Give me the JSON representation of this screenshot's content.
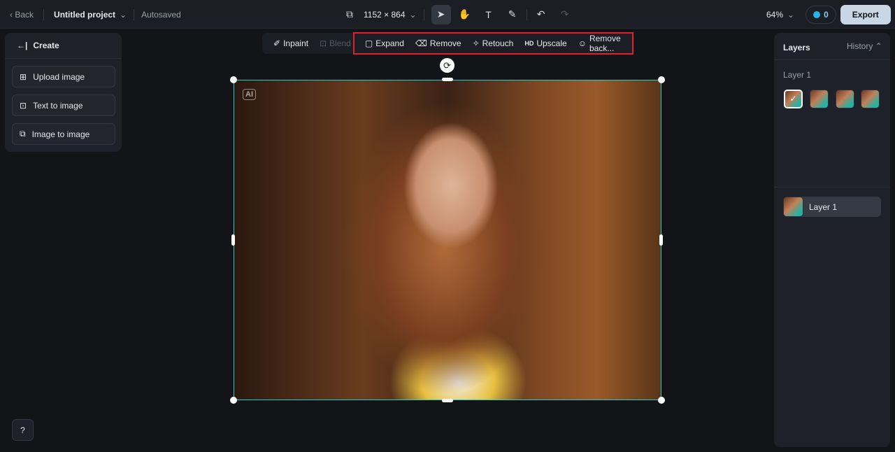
{
  "topbar": {
    "back": "Back",
    "project": "Untitled project",
    "status": "Autosaved",
    "size": "1152 × 864",
    "zoom": "64%",
    "credits": "0",
    "export": "Export"
  },
  "left": {
    "title": "Create",
    "items": [
      "Upload image",
      "Text to image",
      "Image to image"
    ]
  },
  "toolbar": {
    "items": [
      "Inpaint",
      "Blend",
      "Expand",
      "Remove",
      "Retouch",
      "Upscale",
      "Remove back..."
    ],
    "hd": "HD"
  },
  "canvas": {
    "badge": "AI"
  },
  "right": {
    "tab_layers": "Layers",
    "tab_history": "History",
    "group": "Layer 1",
    "layer": "Layer 1"
  }
}
